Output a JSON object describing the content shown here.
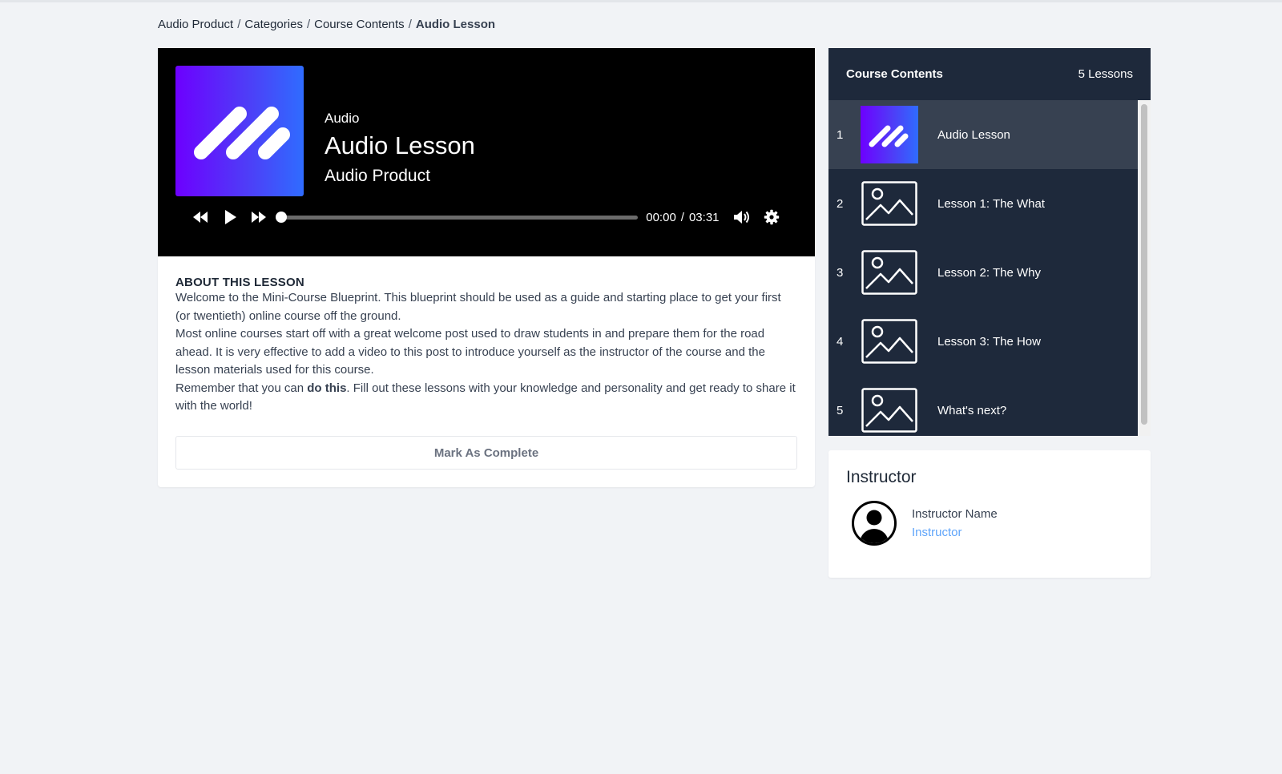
{
  "breadcrumb": {
    "items": [
      "Audio Product",
      "Categories",
      "Course Contents"
    ],
    "current": "Audio Lesson",
    "separator": "/"
  },
  "player": {
    "kind": "Audio",
    "title": "Audio Lesson",
    "product": "Audio Product",
    "time_current": "00:00",
    "time_separator": "/",
    "time_total": "03:31",
    "progress_fraction": 0.0,
    "icons": [
      "rewind-icon",
      "play-icon",
      "fast-forward-icon",
      "volume-icon",
      "gear-icon"
    ]
  },
  "about": {
    "heading": "ABOUT THIS LESSON",
    "p1": "Welcome to the Mini-Course Blueprint. This blueprint should be used as a guide and starting place to get your first (or twentieth) online course off the ground.",
    "p2": "Most online courses start off with a great welcome post used to draw students in and prepare them for the road ahead. It is very effective to add a video to this post to introduce yourself as the instructor of the course and the lesson materials used for this course.",
    "p3_before": "Remember that you can ",
    "p3_bold": "do this",
    "p3_after": ". Fill out these lessons with your knowledge and personality and get ready to share it with the world!",
    "complete_button": "Mark As Complete"
  },
  "contents": {
    "heading": "Course Contents",
    "count": "5 Lessons",
    "lessons": [
      {
        "num": "1",
        "label": "Audio Lesson",
        "thumb": "brand-logo-icon",
        "active": true
      },
      {
        "num": "2",
        "label": "Lesson 1: The What",
        "thumb": "image-placeholder-icon",
        "active": false
      },
      {
        "num": "3",
        "label": "Lesson 2: The Why",
        "thumb": "image-placeholder-icon",
        "active": false
      },
      {
        "num": "4",
        "label": "Lesson 3: The How",
        "thumb": "image-placeholder-icon",
        "active": false
      },
      {
        "num": "5",
        "label": "What's next?",
        "thumb": "image-placeholder-icon",
        "active": false
      }
    ]
  },
  "instructor": {
    "heading": "Instructor",
    "name": "Instructor Name",
    "role": "Instructor"
  },
  "colors": {
    "page_bg": "#f1f3f6",
    "sidebar_bg": "#1e293b",
    "active_lesson_bg": "#374151",
    "brand_gradient_start": "#6d00ff",
    "brand_gradient_end": "#2f6cff",
    "link": "#60a5fa"
  }
}
